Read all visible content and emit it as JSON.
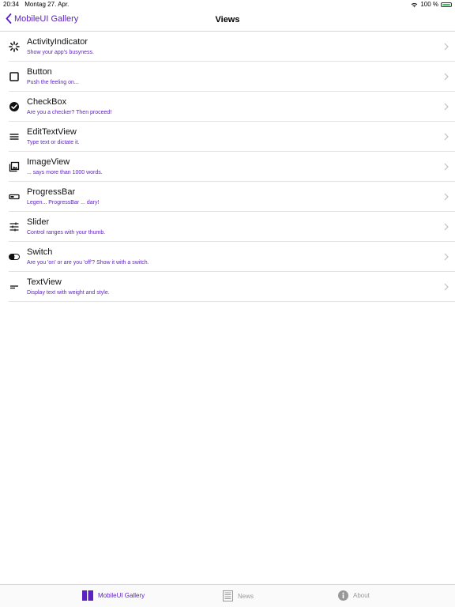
{
  "status": {
    "time": "20:34",
    "date": "Montag 27. Apr.",
    "battery_percent": "100 %",
    "battery_level": 1.0
  },
  "nav": {
    "back_label": "MobileUI Gallery",
    "title": "Views"
  },
  "items": [
    {
      "icon": "activity-indicator-icon",
      "title": "ActivityIndicator",
      "subtitle": "Show your app's busyness."
    },
    {
      "icon": "checkbox-empty-icon",
      "title": "Button",
      "subtitle": "Push the feeling on..."
    },
    {
      "icon": "check-circle-icon",
      "title": "CheckBox",
      "subtitle": "Are you a checker? Then proceed!"
    },
    {
      "icon": "menu-lines-icon",
      "title": "EditTextView",
      "subtitle": "Type text or dictate it."
    },
    {
      "icon": "image-gallery-icon",
      "title": "ImageView",
      "subtitle": "... says more than 1000 words."
    },
    {
      "icon": "progress-bar-icon",
      "title": "ProgressBar",
      "subtitle": "Legen... ProgressBar ... dary!"
    },
    {
      "icon": "sliders-icon",
      "title": "Slider",
      "subtitle": "Control ranges with your thumb."
    },
    {
      "icon": "toggle-icon",
      "title": "Switch",
      "subtitle": "Are you 'on' or are you 'off'? Show it with a switch."
    },
    {
      "icon": "short-text-icon",
      "title": "TextView",
      "subtitle": "Display text with weight and style."
    }
  ],
  "tabs": [
    {
      "icon": "gallery-icon",
      "label": "MobileUI Gallery",
      "active": true
    },
    {
      "icon": "news-icon",
      "label": "News",
      "active": false
    },
    {
      "icon": "info-icon",
      "label": "About",
      "active": false
    }
  ],
  "colors": {
    "accent": "#5b1fc4",
    "inactive": "#999999",
    "separator": "#e3e3e3"
  }
}
